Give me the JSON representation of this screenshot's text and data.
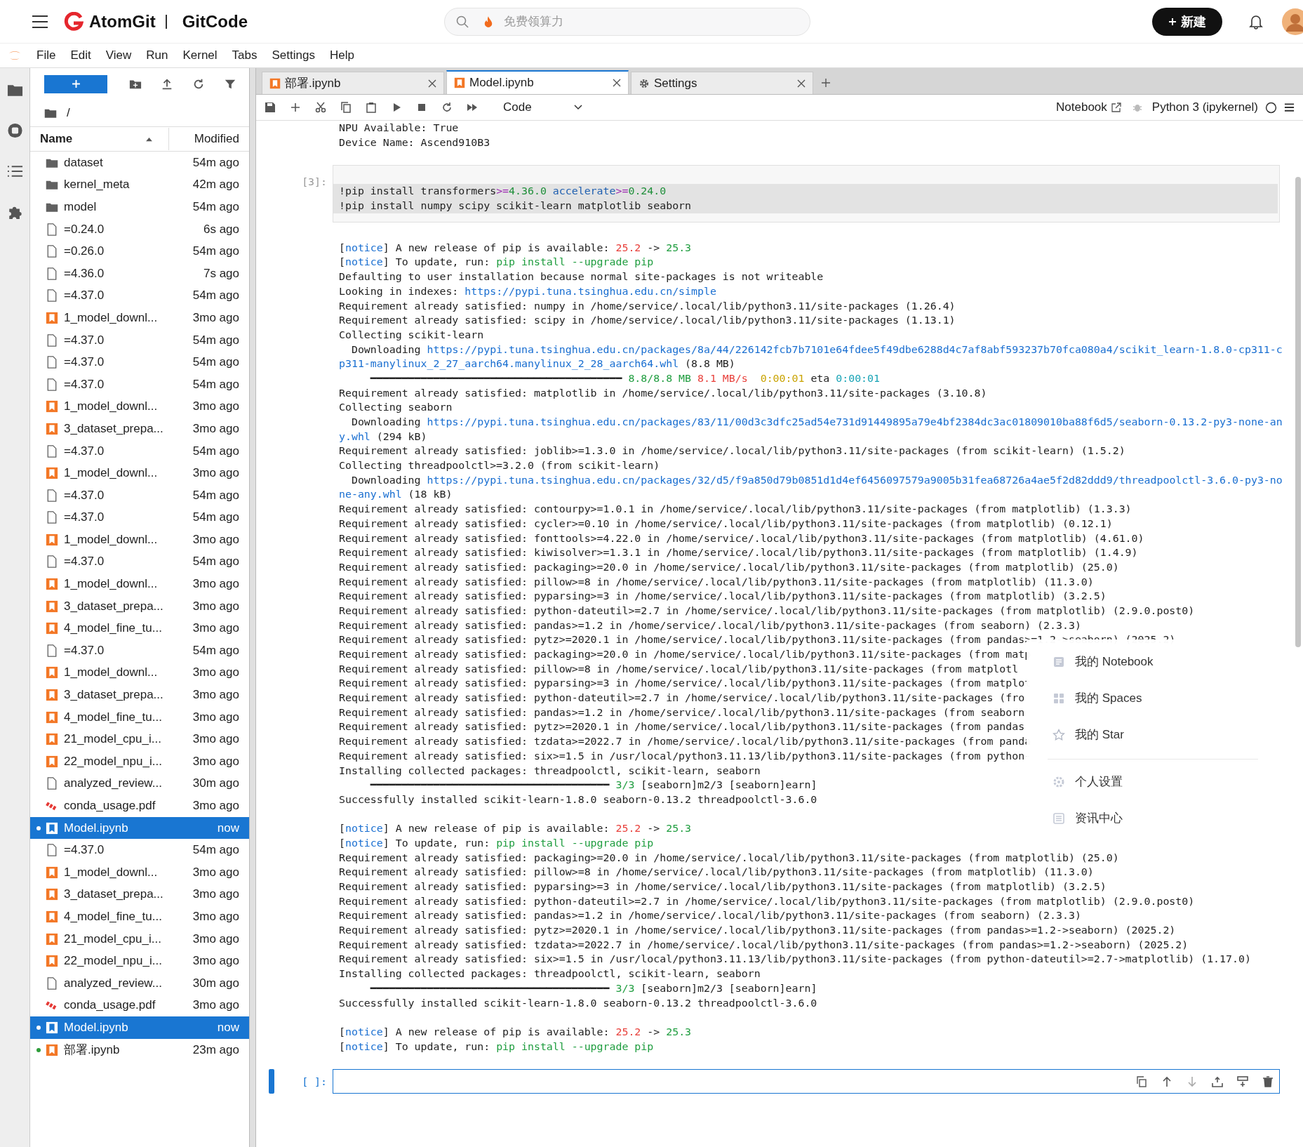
{
  "header": {
    "brand": "AtomGit",
    "product": "GitCode",
    "search": {
      "placeholder": "免费领算力"
    },
    "new_button": "新建"
  },
  "menu_bar": [
    "File",
    "Edit",
    "View",
    "Run",
    "Kernel",
    "Tabs",
    "Settings",
    "Help"
  ],
  "file_browser": {
    "path": "/",
    "columns": [
      "Name",
      "Modified"
    ],
    "rows": [
      {
        "name": "dataset",
        "modified": "54m ago",
        "kind": "folder",
        "selected": false,
        "running": false
      },
      {
        "name": "kernel_meta",
        "modified": "42m ago",
        "kind": "folder",
        "selected": false,
        "running": false
      },
      {
        "name": "model",
        "modified": "54m ago",
        "kind": "folder",
        "selected": false,
        "running": false
      },
      {
        "name": "=0.24.0",
        "modified": "6s ago",
        "kind": "file",
        "selected": false,
        "running": false
      },
      {
        "name": "=0.26.0",
        "modified": "54m ago",
        "kind": "file",
        "selected": false,
        "running": false
      },
      {
        "name": "=4.36.0",
        "modified": "7s ago",
        "kind": "file",
        "selected": false,
        "running": false
      },
      {
        "name": "=4.37.0",
        "modified": "54m ago",
        "kind": "file",
        "selected": false,
        "running": false
      },
      {
        "name": "1_model_downl...",
        "modified": "3mo ago",
        "kind": "notebook",
        "selected": false,
        "running": false
      },
      {
        "name": "=4.37.0",
        "modified": "54m ago",
        "kind": "file",
        "selected": false,
        "running": false
      },
      {
        "name": "=4.37.0",
        "modified": "54m ago",
        "kind": "file",
        "selected": false,
        "running": false
      },
      {
        "name": "=4.37.0",
        "modified": "54m ago",
        "kind": "file",
        "selected": false,
        "running": false
      },
      {
        "name": "1_model_downl...",
        "modified": "3mo ago",
        "kind": "notebook",
        "selected": false,
        "running": false
      },
      {
        "name": "3_dataset_prepa...",
        "modified": "3mo ago",
        "kind": "notebook",
        "selected": false,
        "running": false
      },
      {
        "name": "=4.37.0",
        "modified": "54m ago",
        "kind": "file",
        "selected": false,
        "running": false
      },
      {
        "name": "1_model_downl...",
        "modified": "3mo ago",
        "kind": "notebook",
        "selected": false,
        "running": false
      },
      {
        "name": "=4.37.0",
        "modified": "54m ago",
        "kind": "file",
        "selected": false,
        "running": false
      },
      {
        "name": "=4.37.0",
        "modified": "54m ago",
        "kind": "file",
        "selected": false,
        "running": false
      },
      {
        "name": "1_model_downl...",
        "modified": "3mo ago",
        "kind": "notebook",
        "selected": false,
        "running": false
      },
      {
        "name": "=4.37.0",
        "modified": "54m ago",
        "kind": "file",
        "selected": false,
        "running": false
      },
      {
        "name": "1_model_downl...",
        "modified": "3mo ago",
        "kind": "notebook",
        "selected": false,
        "running": false
      },
      {
        "name": "3_dataset_prepa...",
        "modified": "3mo ago",
        "kind": "notebook",
        "selected": false,
        "running": false
      },
      {
        "name": "4_model_fine_tu...",
        "modified": "3mo ago",
        "kind": "notebook",
        "selected": false,
        "running": false
      },
      {
        "name": "=4.37.0",
        "modified": "54m ago",
        "kind": "file",
        "selected": false,
        "running": false
      },
      {
        "name": "1_model_downl...",
        "modified": "3mo ago",
        "kind": "notebook",
        "selected": false,
        "running": false
      },
      {
        "name": "3_dataset_prepa...",
        "modified": "3mo ago",
        "kind": "notebook",
        "selected": false,
        "running": false
      },
      {
        "name": "4_model_fine_tu...",
        "modified": "3mo ago",
        "kind": "notebook",
        "selected": false,
        "running": false
      },
      {
        "name": "21_model_cpu_i...",
        "modified": "3mo ago",
        "kind": "notebook",
        "selected": false,
        "running": false
      },
      {
        "name": "22_model_npu_i...",
        "modified": "3mo ago",
        "kind": "notebook",
        "selected": false,
        "running": false
      },
      {
        "name": "analyzed_review...",
        "modified": "30m ago",
        "kind": "file",
        "selected": false,
        "running": false
      },
      {
        "name": "conda_usage.pdf",
        "modified": "3mo ago",
        "kind": "pdf",
        "selected": false,
        "running": false
      },
      {
        "name": "Model.ipynb",
        "modified": "now",
        "kind": "notebook",
        "selected": true,
        "running": true
      },
      {
        "name": "=4.37.0",
        "modified": "54m ago",
        "kind": "file",
        "selected": false,
        "running": false
      },
      {
        "name": "1_model_downl...",
        "modified": "3mo ago",
        "kind": "notebook",
        "selected": false,
        "running": false
      },
      {
        "name": "3_dataset_prepa...",
        "modified": "3mo ago",
        "kind": "notebook",
        "selected": false,
        "running": false
      },
      {
        "name": "4_model_fine_tu...",
        "modified": "3mo ago",
        "kind": "notebook",
        "selected": false,
        "running": false
      },
      {
        "name": "21_model_cpu_i...",
        "modified": "3mo ago",
        "kind": "notebook",
        "selected": false,
        "running": false
      },
      {
        "name": "22_model_npu_i...",
        "modified": "3mo ago",
        "kind": "notebook",
        "selected": false,
        "running": false
      },
      {
        "name": "analyzed_review...",
        "modified": "30m ago",
        "kind": "file",
        "selected": false,
        "running": false
      },
      {
        "name": "conda_usage.pdf",
        "modified": "3mo ago",
        "kind": "pdf",
        "selected": false,
        "running": false
      },
      {
        "name": "Model.ipynb",
        "modified": "now",
        "kind": "notebook",
        "selected": true,
        "running": true
      },
      {
        "name": "部署.ipynb",
        "modified": "23m ago",
        "kind": "notebook",
        "selected": false,
        "running": true
      }
    ]
  },
  "tabs": [
    {
      "label": "部署.ipynb",
      "kind": "notebook",
      "selected": false
    },
    {
      "label": "Model.ipynb",
      "kind": "notebook",
      "selected": true
    },
    {
      "label": "Settings",
      "kind": "settings",
      "selected": false
    }
  ],
  "notebook_toolbar": {
    "cell_type": "Code",
    "notebook_link": "Notebook",
    "kernel": "Python 3 (ipykernel)"
  },
  "previous_output": [
    "NPU Available: True",
    "Device Name: Ascend910B3"
  ],
  "code_cell": {
    "prompt": "[3]:",
    "lines": [
      {
        "segments": [
          {
            "text": "!pip install transformers"
          },
          {
            "text": ">=",
            "color": "#9b27b0"
          },
          {
            "text": "4.36.0",
            "color": "#1f8f3a"
          },
          {
            "text": " accelerate",
            "color": "#1f5fb0"
          },
          {
            "text": ">=",
            "color": "#9b27b0"
          },
          {
            "text": "0.24.0",
            "color": "#1f8f3a"
          }
        ]
      },
      {
        "text": "!pip install numpy scipy scikit-learn matplotlib seaborn"
      }
    ],
    "output_blocks": [
      [
        {
          "segments": [
            {
              "text": "["
            },
            {
              "text": "notice",
              "color": "#1a6fd1"
            },
            {
              "text": "] A new release of pip is available: "
            },
            {
              "text": "25.2",
              "color": "#e8413c"
            },
            {
              "text": " -> "
            },
            {
              "text": "25.3",
              "color": "#1f9d3f"
            }
          ]
        },
        {
          "segments": [
            {
              "text": "["
            },
            {
              "text": "notice",
              "color": "#1a6fd1"
            },
            {
              "text": "] To update, run: "
            },
            {
              "text": "pip install --upgrade pip",
              "color": "#1f9d3f"
            }
          ]
        },
        {
          "text": "Defaulting to user installation because normal site-packages is not writeable"
        },
        {
          "segments": [
            {
              "text": "Looking in indexes: "
            },
            {
              "text": "https://pypi.tuna.tsinghua.edu.cn/simple",
              "color": "#1a6fd1"
            }
          ]
        },
        {
          "text": "Requirement already satisfied: numpy in /home/service/.local/lib/python3.11/site-packages (1.26.4)"
        },
        {
          "text": "Requirement already satisfied: scipy in /home/service/.local/lib/python3.11/site-packages (1.13.1)"
        },
        {
          "text": "Collecting scikit-learn"
        },
        {
          "segments": [
            {
              "text": "  Downloading "
            },
            {
              "text": "https://pypi.tuna.tsinghua.edu.cn/packages/8a/44/226142fcb7b7101e64fdee5f49dbe6288d4c7af8abf593237b70fca080a4/scikit_learn-1.8.0-cp311-c",
              "color": "#1a6fd1"
            }
          ]
        },
        {
          "segments": [
            {
              "text": "p311-manylinux_2_27_aarch64.manylinux_2_28_aarch64.whl",
              "color": "#1a6fd1"
            },
            {
              "text": " (8.8 MB)"
            }
          ]
        },
        {
          "segments": [
            {
              "text": "     ━━━━━━━━━━━━━━━━━━━━━━━━━━━━━━━━━━━━━━━━"
            },
            {
              "text": " 8.8/8.8 MB",
              "color": "#1f9d3f"
            },
            {
              "text": " 8.1 MB/s",
              "color": "#e8413c"
            },
            {
              "text": "  0:00:01",
              "color": "#c9a300"
            },
            {
              "text": " eta "
            },
            {
              "text": "0:00:01",
              "color": "#17a3b5"
            }
          ]
        },
        {
          "text": "Requirement already satisfied: matplotlib in /home/service/.local/lib/python3.11/site-packages (3.10.8)"
        },
        {
          "text": "Collecting seaborn"
        },
        {
          "segments": [
            {
              "text": "  Downloading "
            },
            {
              "text": "https://pypi.tuna.tsinghua.edu.cn/packages/83/11/00d3c3dfc25ad54e731d91449895a79e4bf2384dc3ac01809010ba88f6d5/seaborn-0.13.2-py3-none-an",
              "color": "#1a6fd1"
            }
          ]
        },
        {
          "segments": [
            {
              "text": "y.whl",
              "color": "#1a6fd1"
            },
            {
              "text": " (294 kB)"
            }
          ]
        },
        {
          "text": "Requirement already satisfied: joblib>=1.3.0 in /home/service/.local/lib/python3.11/site-packages (from scikit-learn) (1.5.2)"
        },
        {
          "text": "Collecting threadpoolctl>=3.2.0 (from scikit-learn)"
        },
        {
          "segments": [
            {
              "text": "  Downloading "
            },
            {
              "text": "https://pypi.tuna.tsinghua.edu.cn/packages/32/d5/f9a850d79b0851d1d4ef6456097579a9005b31fea68726a4ae5f2d82ddd9/threadpoolctl-3.6.0-py3-no",
              "color": "#1a6fd1"
            }
          ]
        },
        {
          "segments": [
            {
              "text": "ne-any.whl",
              "color": "#1a6fd1"
            },
            {
              "text": " (18 kB)"
            }
          ]
        },
        {
          "text": "Requirement already satisfied: contourpy>=1.0.1 in /home/service/.local/lib/python3.11/site-packages (from matplotlib) (1.3.3)"
        },
        {
          "text": "Requirement already satisfied: cycler>=0.10 in /home/service/.local/lib/python3.11/site-packages (from matplotlib) (0.12.1)"
        },
        {
          "text": "Requirement already satisfied: fonttools>=4.22.0 in /home/service/.local/lib/python3.11/site-packages (from matplotlib) (4.61.0)"
        },
        {
          "text": "Requirement already satisfied: kiwisolver>=1.3.1 in /home/service/.local/lib/python3.11/site-packages (from matplotlib) (1.4.9)"
        },
        {
          "text": "Requirement already satisfied: packaging>=20.0 in /home/service/.local/lib/python3.11/site-packages (from matplotlib) (25.0)"
        },
        {
          "text": "Requirement already satisfied: pillow>=8 in /home/service/.local/lib/python3.11/site-packages (from matplotlib) (11.3.0)"
        },
        {
          "text": "Requirement already satisfied: pyparsing>=3 in /home/service/.local/lib/python3.11/site-packages (from matplotlib) (3.2.5)"
        },
        {
          "text": "Requirement already satisfied: python-dateutil>=2.7 in /home/service/.local/lib/python3.11/site-packages (from matplotlib) (2.9.0.post0)"
        },
        {
          "text": "Requirement already satisfied: pandas>=1.2 in /home/service/.local/lib/python3.11/site-packages (from seaborn) (2.3.3)"
        },
        {
          "text": "Requirement already satisfied: pytz>=2020.1 in /home/service/.local/lib/python3.11/site-packages (from pandas>=1.2->seaborn) (2025.2)"
        },
        {
          "text": "Requirement already satisfied: packaging>=20.0 in /home/service/.local/lib/python3.11/site-packages (from matp"
        },
        {
          "text": "Requirement already satisfied: pillow>=8 in /home/service/.local/lib/python3.11/site-packages (from matplotl"
        },
        {
          "text": "Requirement already satisfied: pyparsing>=3 in /home/service/.local/lib/python3.11/site-packages (from matplot"
        },
        {
          "text": "Requirement already satisfied: python-dateutil>=2.7 in /home/service/.local/lib/python3.11/site-packages (fro"
        },
        {
          "text": "Requirement already satisfied: pandas>=1.2 in /home/service/.local/lib/python3.11/site-packages (from seaborn"
        },
        {
          "text": "Requirement already satisfied: pytz>=2020.1 in /home/service/.local/lib/python3.11/site-packages (from pandas"
        },
        {
          "text": "Requirement already satisfied: tzdata>=2022.7 in /home/service/.local/lib/python3.11/site-packages (from panda"
        },
        {
          "text": "Requirement already satisfied: six>=1.5 in /usr/local/python3.11.13/lib/python3.11/site-packages (from python-"
        },
        {
          "text": "Installing collected packages: threadpoolctl, scikit-learn, seaborn"
        },
        {
          "segments": [
            {
              "text": "     ━━━━━━━━━━━━━━━━━━━━━━━━━━━━━━━━━━━━━━"
            },
            {
              "text": " 3/3",
              "color": "#1f9d3f"
            },
            {
              "text": " [seaborn]m2/3 [seaborn]earn]"
            }
          ]
        },
        {
          "text": "Successfully installed scikit-learn-1.8.0 seaborn-0.13.2 threadpoolctl-3.6.0"
        }
      ],
      [
        {
          "segments": [
            {
              "text": "["
            },
            {
              "text": "notice",
              "color": "#1a6fd1"
            },
            {
              "text": "] A new release of pip is available: "
            },
            {
              "text": "25.2",
              "color": "#e8413c"
            },
            {
              "text": " -> "
            },
            {
              "text": "25.3",
              "color": "#1f9d3f"
            }
          ]
        },
        {
          "segments": [
            {
              "text": "["
            },
            {
              "text": "notice",
              "color": "#1a6fd1"
            },
            {
              "text": "] To update, run: "
            },
            {
              "text": "pip install --upgrade pip",
              "color": "#1f9d3f"
            }
          ]
        },
        {
          "text": "Requirement already satisfied: packaging>=20.0 in /home/service/.local/lib/python3.11/site-packages (from matplotlib) (25.0)"
        },
        {
          "text": "Requirement already satisfied: pillow>=8 in /home/service/.local/lib/python3.11/site-packages (from matplotlib) (11.3.0)"
        },
        {
          "text": "Requirement already satisfied: pyparsing>=3 in /home/service/.local/lib/python3.11/site-packages (from matplotlib) (3.2.5)"
        },
        {
          "text": "Requirement already satisfied: python-dateutil>=2.7 in /home/service/.local/lib/python3.11/site-packages (from matplotlib) (2.9.0.post0)"
        },
        {
          "text": "Requirement already satisfied: pandas>=1.2 in /home/service/.local/lib/python3.11/site-packages (from seaborn) (2.3.3)"
        },
        {
          "text": "Requirement already satisfied: pytz>=2020.1 in /home/service/.local/lib/python3.11/site-packages (from pandas>=1.2->seaborn) (2025.2)"
        },
        {
          "text": "Requirement already satisfied: tzdata>=2022.7 in /home/service/.local/lib/python3.11/site-packages (from pandas>=1.2->seaborn) (2025.2)"
        },
        {
          "text": "Requirement already satisfied: six>=1.5 in /usr/local/python3.11.13/lib/python3.11/site-packages (from python-dateutil>=2.7->matplotlib) (1.17.0)"
        },
        {
          "text": "Installing collected packages: threadpoolctl, scikit-learn, seaborn"
        },
        {
          "segments": [
            {
              "text": "     ━━━━━━━━━━━━━━━━━━━━━━━━━━━━━━━━━━━━━━"
            },
            {
              "text": " 3/3",
              "color": "#1f9d3f"
            },
            {
              "text": " [seaborn]m2/3 [seaborn]earn]"
            }
          ]
        },
        {
          "text": "Successfully installed scikit-learn-1.8.0 seaborn-0.13.2 threadpoolctl-3.6.0"
        }
      ],
      [
        {
          "segments": [
            {
              "text": "["
            },
            {
              "text": "notice",
              "color": "#1a6fd1"
            },
            {
              "text": "] A new release of pip is available: "
            },
            {
              "text": "25.2",
              "color": "#e8413c"
            },
            {
              "text": " -> "
            },
            {
              "text": "25.3",
              "color": "#1f9d3f"
            }
          ]
        },
        {
          "segments": [
            {
              "text": "["
            },
            {
              "text": "notice",
              "color": "#1a6fd1"
            },
            {
              "text": "] To update, run: "
            },
            {
              "text": "pip install --upgrade pip",
              "color": "#1f9d3f"
            }
          ]
        }
      ]
    ]
  },
  "input_cell": {
    "prompt": "[ ]:"
  },
  "user_menu": {
    "sections": [
      [
        {
          "label": "我的 Notebook",
          "kind": "notebook"
        },
        {
          "label": "我的 Spaces",
          "kind": "spaces"
        },
        {
          "label": "我的 Star",
          "kind": "star"
        }
      ],
      [
        {
          "label": "个人设置",
          "kind": "settings"
        },
        {
          "label": "资讯中心",
          "kind": "news"
        }
      ]
    ]
  }
}
